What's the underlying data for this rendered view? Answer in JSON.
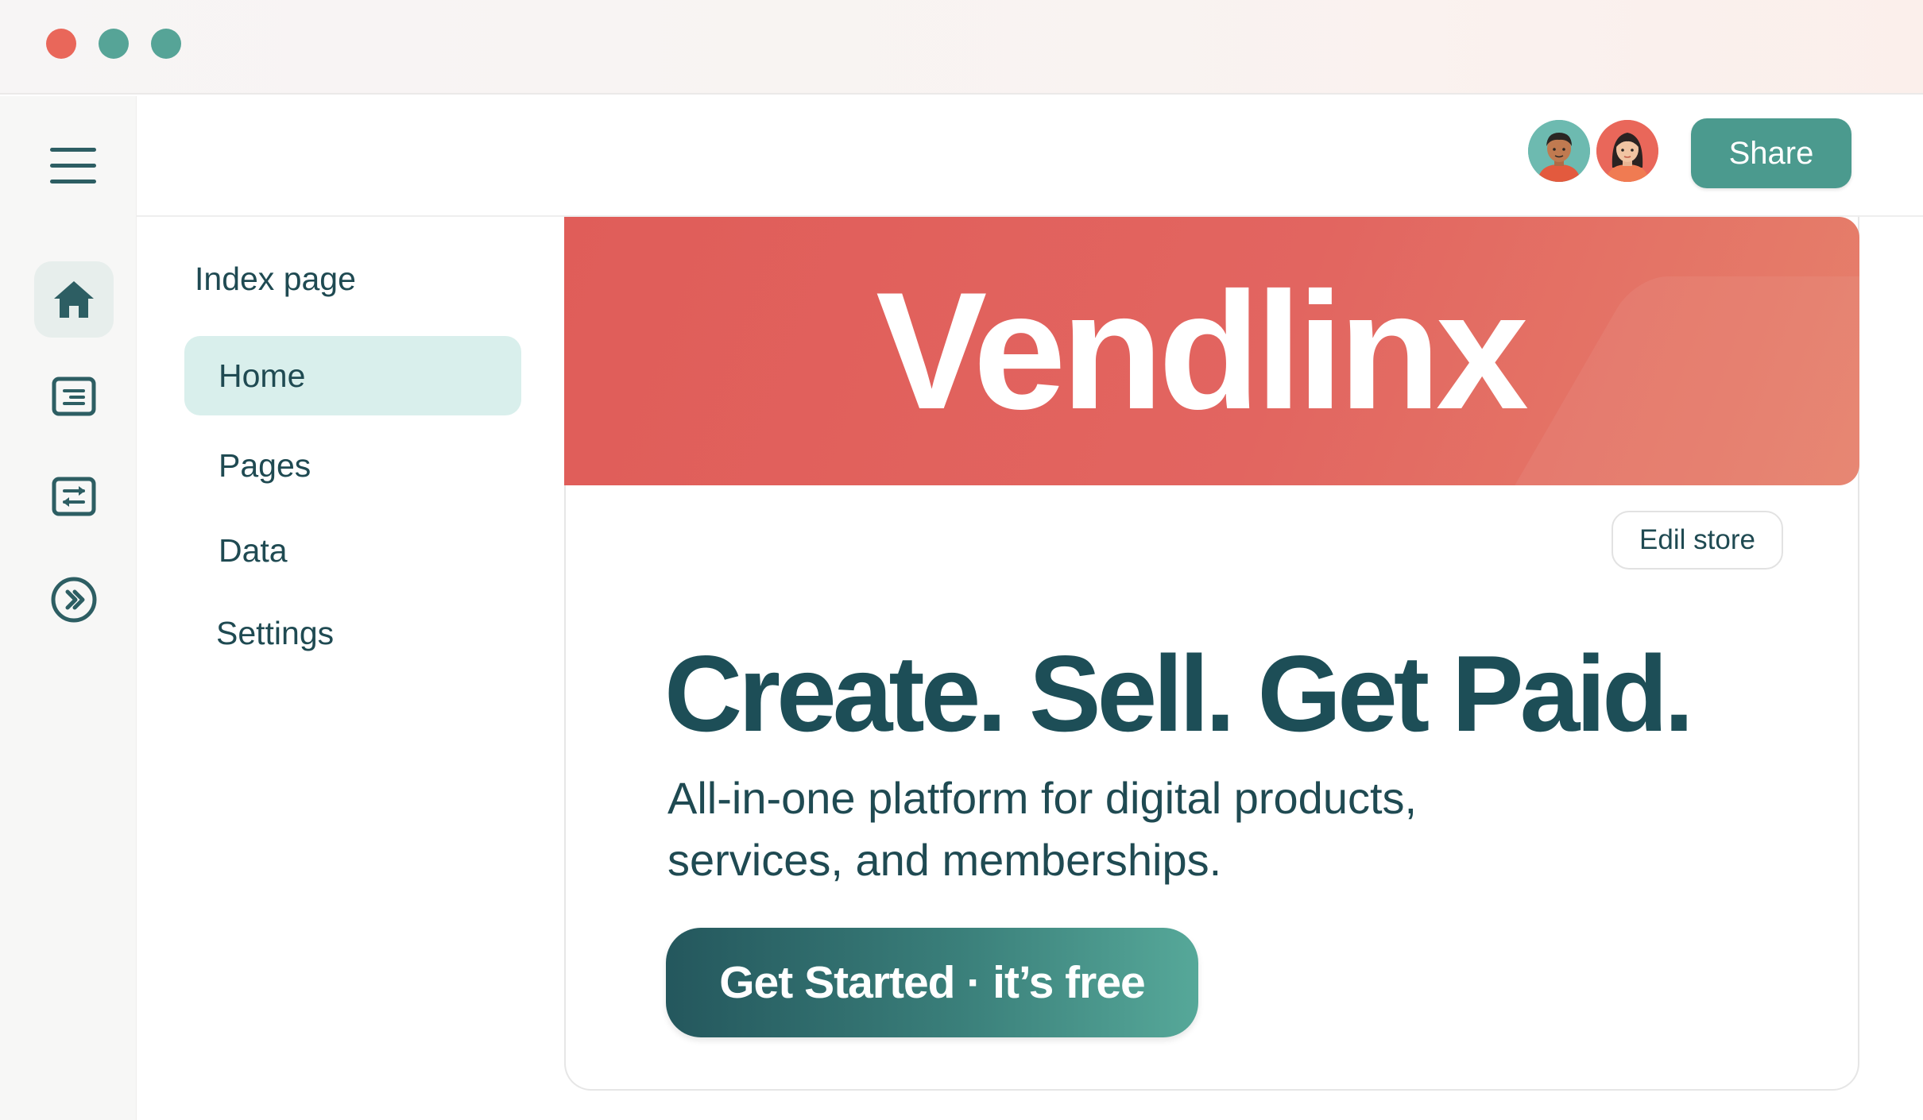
{
  "window": {
    "controls": [
      "close",
      "minimize",
      "maximize"
    ],
    "colors": {
      "close": "#e9675a",
      "minimize": "#56a497",
      "maximize": "#56a497"
    }
  },
  "rail": {
    "items": [
      {
        "icon": "menu-icon"
      },
      {
        "icon": "home-icon",
        "active": true
      },
      {
        "icon": "document-icon"
      },
      {
        "icon": "transfer-icon"
      },
      {
        "icon": "forward-circle-icon"
      }
    ]
  },
  "header": {
    "collaborators": [
      "collaborator-avatar",
      "collaborator-avatar"
    ],
    "share_label": "Share"
  },
  "sidebar": {
    "title": "Index page",
    "items": [
      {
        "label": "Home",
        "active": true
      },
      {
        "label": "Pages"
      },
      {
        "label": "Data"
      },
      {
        "label": "Settings"
      }
    ]
  },
  "store": {
    "brand": "Vendlinx",
    "edit_label": "Edil store",
    "headline": "Create. Sell. Get Paid.",
    "subline_1": "All-in-one platform for digital products,",
    "subline_2": "services, and memberships.",
    "cta_label": "Get Started · it’s free"
  },
  "colors": {
    "accent": "#4b9a8e",
    "brand_banner": "#e05d59",
    "text_dark": "#1d4e57",
    "active_nav": "#d9efec"
  }
}
